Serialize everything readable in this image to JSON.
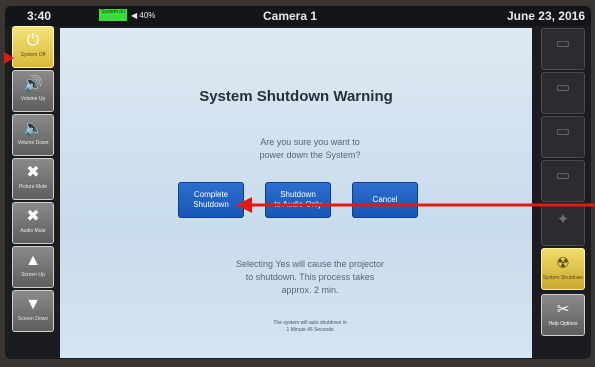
{
  "status_bar": {
    "time": "3:40",
    "badge": "System on",
    "volume": "◀ 40%",
    "title": "Camera 1",
    "date": "June 23, 2016"
  },
  "left_buttons": [
    {
      "icon": "power-icon",
      "glyph": "⏻",
      "label": "System Off",
      "active": true
    },
    {
      "icon": "volume-up-icon",
      "glyph": "🔊",
      "label": "Volume Up",
      "active": false
    },
    {
      "icon": "volume-down-icon",
      "glyph": "🔈",
      "label": "Volume Down",
      "active": false
    },
    {
      "icon": "picture-mute-icon",
      "glyph": "✖",
      "label": "Picture Mute",
      "active": false
    },
    {
      "icon": "audio-mute-icon",
      "glyph": "✖",
      "label": "Audio Mute",
      "active": false
    },
    {
      "icon": "arrow-up-icon",
      "glyph": "▲",
      "label": "Screen Up",
      "active": false
    },
    {
      "icon": "arrow-down-icon",
      "glyph": "▼",
      "label": "Screen Down",
      "active": false
    }
  ],
  "right_buttons": [
    {
      "icon": "source-icon",
      "glyph": "▭",
      "label": "",
      "style": "dim"
    },
    {
      "icon": "source-icon",
      "glyph": "▭",
      "label": "",
      "style": "dim"
    },
    {
      "icon": "source-icon",
      "glyph": "▭",
      "label": "",
      "style": "dim"
    },
    {
      "icon": "source-icon",
      "glyph": "▭",
      "label": "",
      "style": "dim"
    },
    {
      "icon": "source-icon",
      "glyph": "✦",
      "label": "",
      "style": "dim"
    },
    {
      "icon": "radiation-icon",
      "glyph": "☢",
      "label": "System Shutdown",
      "style": "active"
    },
    {
      "icon": "tools-icon",
      "glyph": "✂",
      "label": "Help Options",
      "style": "grey"
    }
  ],
  "dialog": {
    "title": "System Shutdown Warning",
    "question_line1": "Are you sure you want to",
    "question_line2": "power down the System?",
    "buttons": [
      {
        "line1": "Complete",
        "line2": "Shutdown"
      },
      {
        "line1": "Shutdown",
        "line2": "to Audio Only"
      },
      {
        "line1": "Cancel",
        "line2": ""
      }
    ],
    "note_line1": "Selecting Yes will cause the projector",
    "note_line2": "to shutdown. This process takes",
    "note_line3": "approx. 2 min.",
    "timer_line1": "The system will auto shutdown in",
    "timer_line2": "1 Minute 46 Seconds"
  },
  "colors": {
    "annotation_arrow": "#e01b12",
    "dialog_button": "#1c5fc4",
    "active_button": "#e6c74a"
  }
}
